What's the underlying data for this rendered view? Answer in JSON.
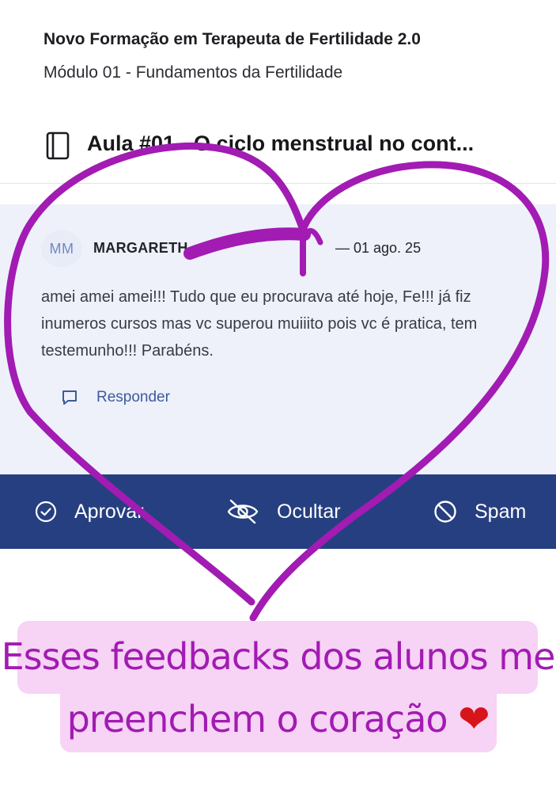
{
  "course": {
    "title": "Novo Formação em Terapeuta de Fertilidade 2.0",
    "module": "Módulo 01 - Fundamentos da Fertilidade"
  },
  "lesson": {
    "icon": "book-icon",
    "title": "Aula #01 - O ciclo menstrual no cont..."
  },
  "comment": {
    "avatar_initials": "MM",
    "author": "MARGARETH",
    "date": "— 01 ago. 25",
    "text": "amei amei amei!!! Tudo que eu procurava até hoje, Fe!!! já fiz inumeros cursos mas vc superou muiiito pois vc é pratica, tem testemunho!!! Parabéns.",
    "reply_label": "Responder",
    "reply_icon": "chat-bubble-icon"
  },
  "actions": {
    "approve_label": "Aprovar",
    "approve_icon": "check-circle-icon",
    "hide_label": "Ocultar",
    "hide_icon": "eye-off-icon",
    "spam_label": "Spam",
    "spam_icon": "block-icon"
  },
  "caption": {
    "line1": "Esses feedbacks dos alunos me",
    "line2": "preenchem o coração",
    "emoji": "❤"
  },
  "colors": {
    "action_bar": "#263f80",
    "card_bg": "#eef1f9",
    "link_blue": "#3d5a9e",
    "scribble_purple": "#a21bb3",
    "caption_bg": "#f7d3f5"
  }
}
